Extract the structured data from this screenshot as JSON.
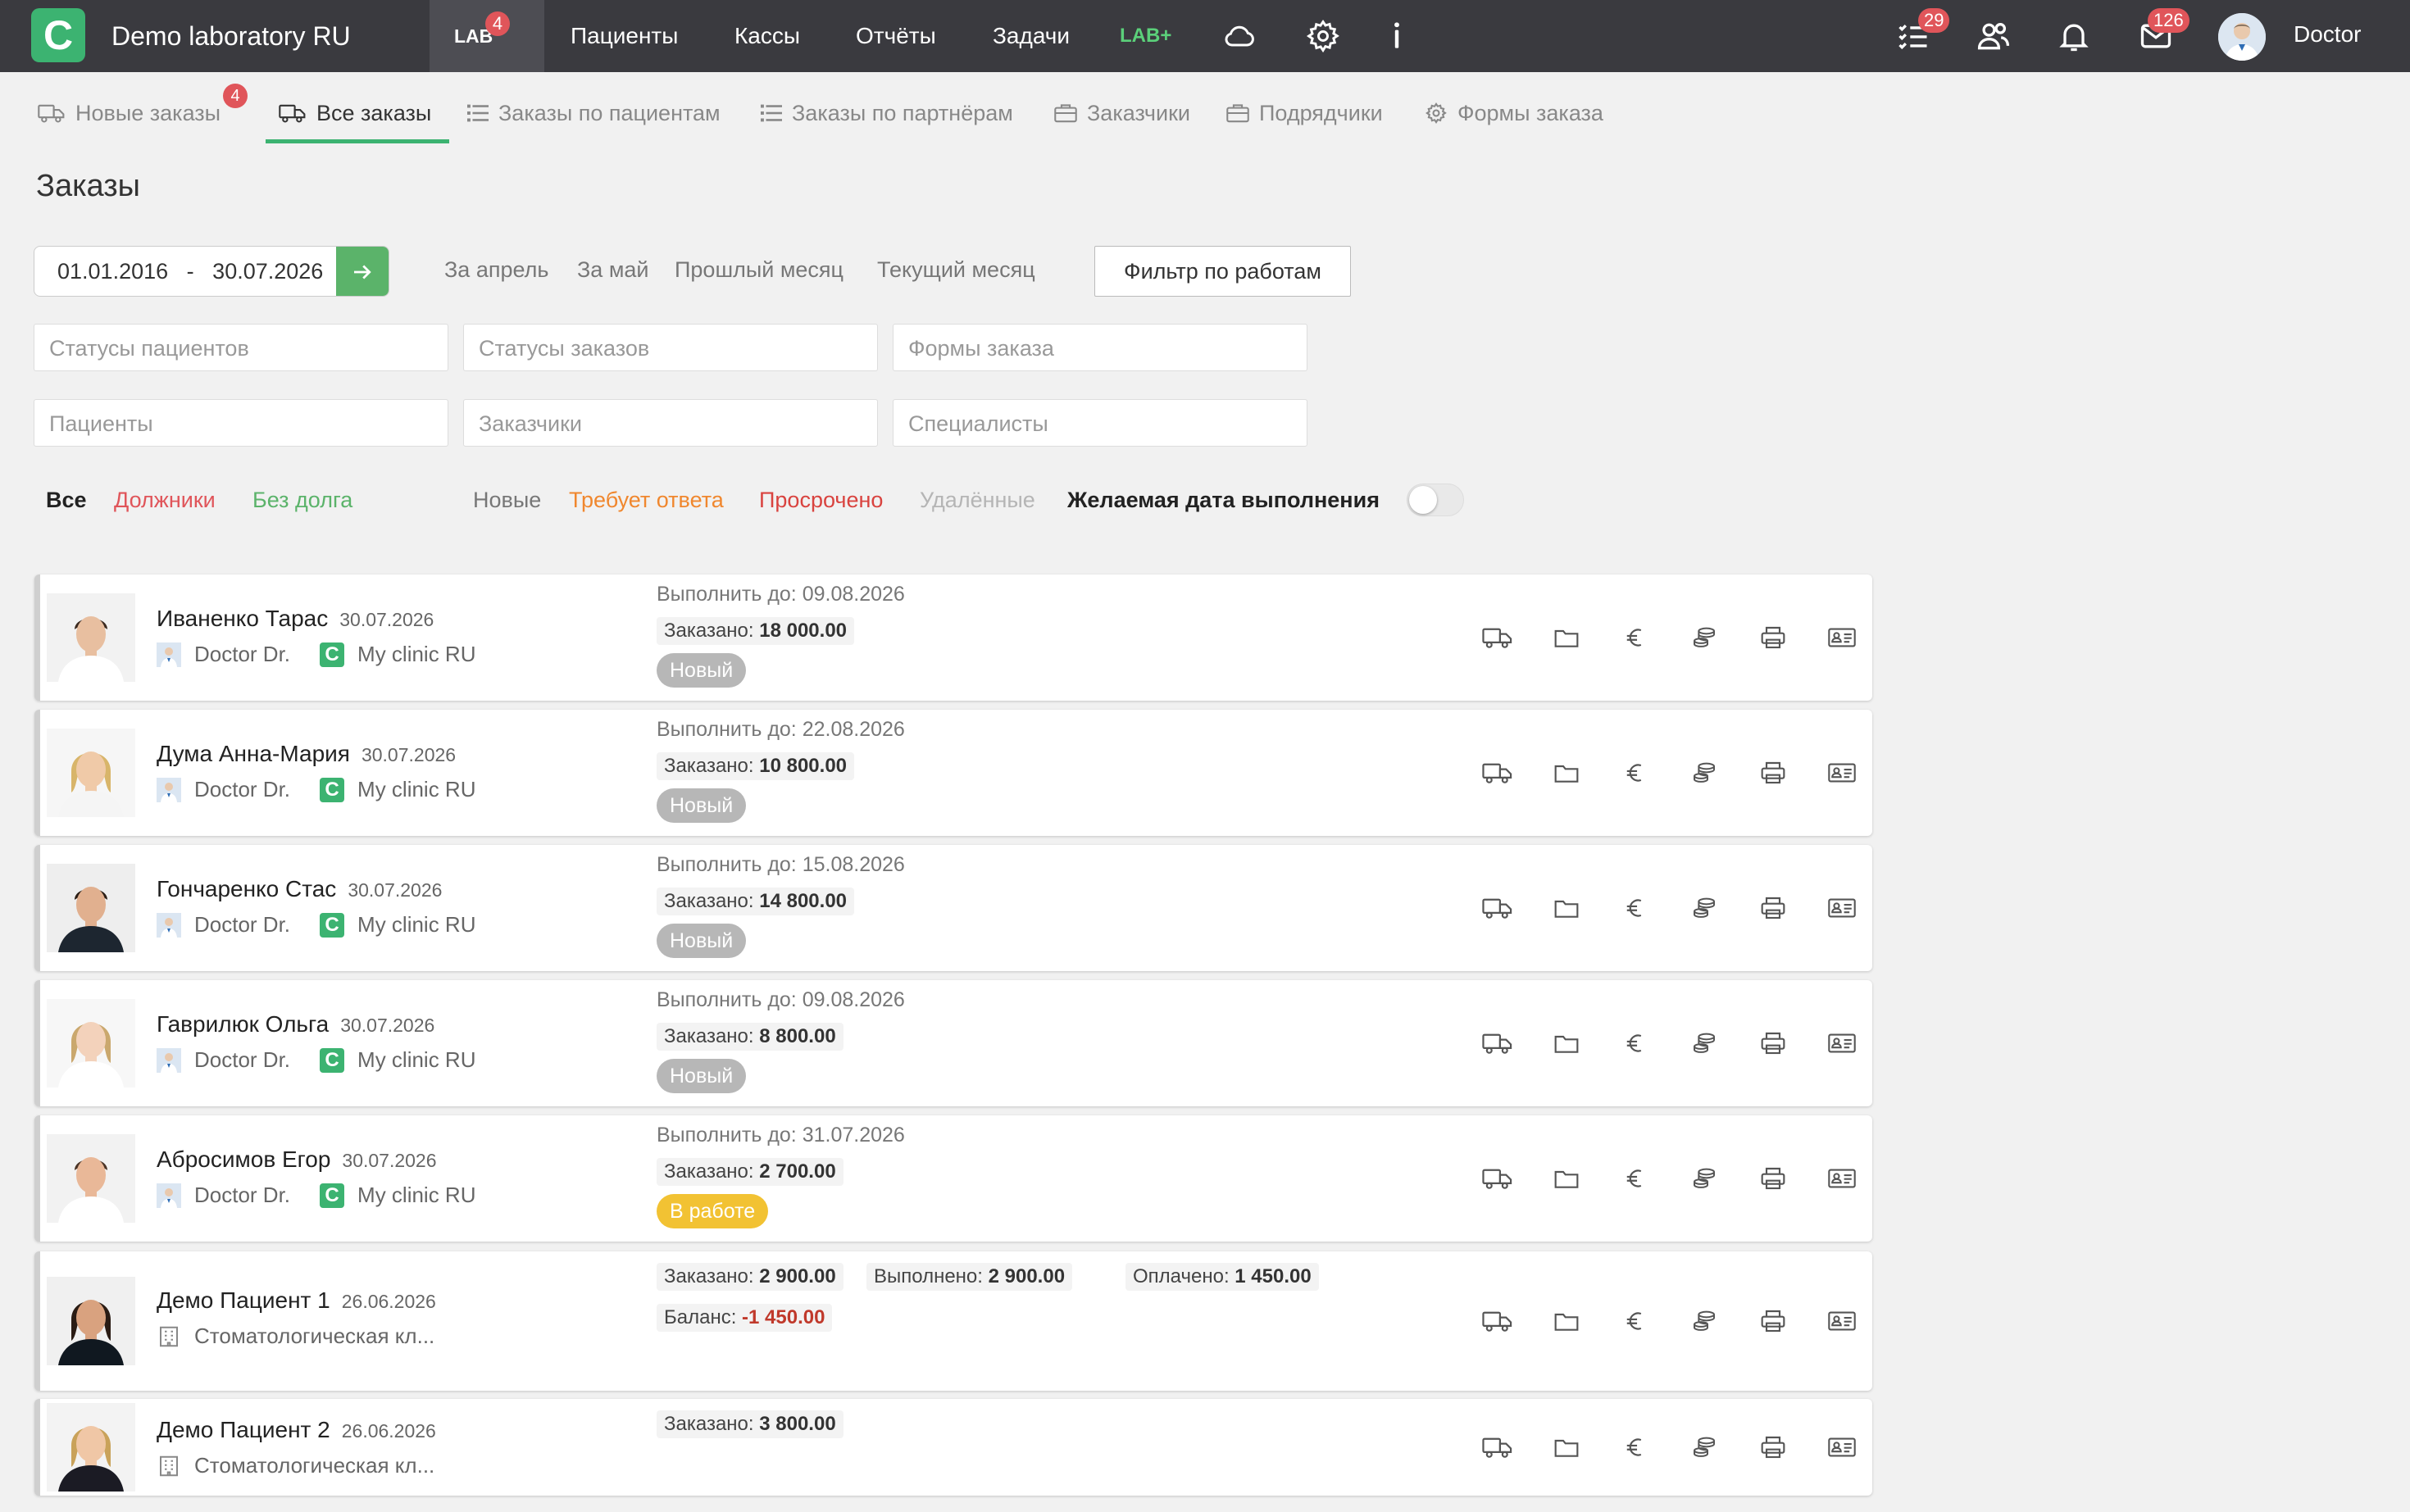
{
  "header": {
    "app_title": "Demo laboratory RU",
    "logo_letter": "C",
    "nav": {
      "lab": "LAB",
      "lab_badge": "4",
      "patients": "Пациенты",
      "cash": "Кассы",
      "reports": "Отчёты",
      "tasks": "Задачи",
      "lab_plus": "LAB+"
    },
    "tasks_badge": "29",
    "messages_badge": "126",
    "user_name": "Doctor"
  },
  "subnav": {
    "new_orders": "Новые заказы",
    "new_orders_badge": "4",
    "all_orders": "Все заказы",
    "by_patients": "Заказы по пациентам",
    "by_partners": "Заказы по партнёрам",
    "customers": "Заказчики",
    "contractors": "Подрядчики",
    "order_forms": "Формы заказа"
  },
  "page_title": "Заказы",
  "date_range": {
    "from": "01.01.2016",
    "sep": "-",
    "to": "30.07.2026"
  },
  "quick_dates": {
    "april": "За апрель",
    "may": "За май",
    "last_month": "Прошлый месяц",
    "current_month": "Текущий месяц"
  },
  "filter_button": "Фильтр по работам",
  "selects": {
    "patient_statuses": "Статусы пациентов",
    "order_statuses": "Статусы заказов",
    "order_forms": "Формы заказа",
    "patients": "Пациенты",
    "customers": "Заказчики",
    "specialists": "Специалисты"
  },
  "filters": {
    "all": "Все",
    "debtors": "Должники",
    "no_debt": "Без долга",
    "new": "Новые",
    "needs_reply": "Требует ответа",
    "overdue": "Просрочено",
    "deleted": "Удалённые",
    "desired_date": "Желаемая дата выполнения"
  },
  "colors": {
    "accent": "#3cb371",
    "debtors": "#e0555a",
    "no_debt": "#5bb36a",
    "needs_reply": "#f0872e",
    "overdue": "#d9433f",
    "status_new": "#b7b7b7",
    "status_work": "#f2c233"
  },
  "orders": [
    {
      "name": "Иваненко Тарас",
      "date": "30.07.2026",
      "doctor": "Doctor Dr.",
      "clinic": "My clinic RU",
      "due_label": "Выполнить до:",
      "due": "09.08.2026",
      "ordered_label": "Заказано:",
      "ordered": "18 000.00",
      "status": "Новый"
    },
    {
      "name": "Дума Анна-Мария",
      "date": "30.07.2026",
      "doctor": "Doctor Dr.",
      "clinic": "My clinic RU",
      "due_label": "Выполнить до:",
      "due": "22.08.2026",
      "ordered_label": "Заказано:",
      "ordered": "10 800.00",
      "status": "Новый"
    },
    {
      "name": "Гончаренко Стас",
      "date": "30.07.2026",
      "doctor": "Doctor Dr.",
      "clinic": "My clinic RU",
      "due_label": "Выполнить до:",
      "due": "15.08.2026",
      "ordered_label": "Заказано:",
      "ordered": "14 800.00",
      "status": "Новый"
    },
    {
      "name": "Гаврилюк Ольга",
      "date": "30.07.2026",
      "doctor": "Doctor Dr.",
      "clinic": "My clinic RU",
      "due_label": "Выполнить до:",
      "due": "09.08.2026",
      "ordered_label": "Заказано:",
      "ordered": "8 800.00",
      "status": "Новый"
    },
    {
      "name": "Абросимов Егор",
      "date": "30.07.2026",
      "doctor": "Doctor Dr.",
      "clinic": "My clinic RU",
      "due_label": "Выполнить до:",
      "due": "31.07.2026",
      "ordered_label": "Заказано:",
      "ordered": "2 700.00",
      "status": "В работе"
    },
    {
      "name": "Демо Пациент 1",
      "date": "26.06.2026",
      "clinic": "Стоматологическая кл...",
      "ordered_label": "Заказано:",
      "ordered": "2 900.00",
      "done_label": "Выполнено:",
      "done": "2 900.00",
      "paid_label": "Оплачено:",
      "paid": "1 450.00",
      "balance_label": "Баланс:",
      "balance": "-1 450.00"
    },
    {
      "name": "Демо Пациент 2",
      "date": "26.06.2026",
      "clinic": "Стоматологическая кл...",
      "ordered_label": "Заказано:",
      "ordered": "3 800.00"
    }
  ]
}
